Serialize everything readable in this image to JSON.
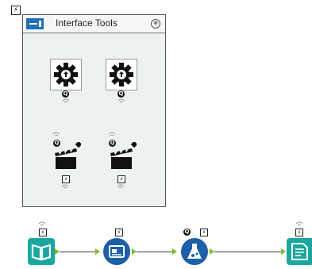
{
  "container": {
    "title": "Interface Tools",
    "collapse_symbol": "⊗"
  },
  "icons": {
    "bolt": "⚡",
    "q": "Q"
  },
  "colors": {
    "container_bg": "#eef1f2",
    "accent_blue": "#1f6fb5",
    "tool_teal": "#1aa7a0",
    "tool_navy": "#1d5fa8",
    "anchor_green": "#7bbf2a"
  },
  "workflow": {
    "nodes": [
      "input-book-icon",
      "browse-window-icon",
      "flask-icon",
      "report-doc-icon"
    ]
  }
}
